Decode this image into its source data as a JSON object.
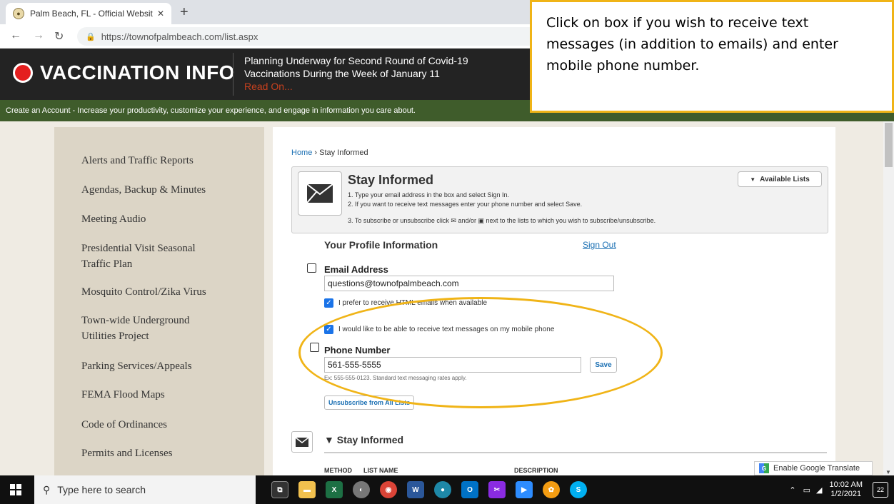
{
  "browser": {
    "tab_title": "Palm Beach, FL - Official Website",
    "tab_close": "✕",
    "new_tab": "+",
    "url": "https://townofpalmbeach.com/list.aspx"
  },
  "header": {
    "vaccination_label": "VACCINATION INFO",
    "news_line1": "Planning Underway for Second Round of Covid-19",
    "news_line2": "Vaccinations During the Week of January 11",
    "read_on": "Read On..."
  },
  "account_bar": "Create an Account - Increase your productivity, customize your experience, and engage in information you care about.",
  "callout_text": "Click on box if you wish to receive text messages (in addition to emails) and enter mobile phone number.",
  "sidebar": {
    "items": [
      "Alerts and Traffic Reports",
      "Agendas, Backup & Minutes",
      "Meeting Audio",
      "Presidential Visit Seasonal Traffic Plan",
      "Mosquito Control/Zika Virus",
      "Town-wide Underground Utilities Project",
      "Parking Services/Appeals",
      "FEMA Flood Maps",
      "Code of Ordinances",
      "Permits and Licenses"
    ]
  },
  "breadcrumb": {
    "home": "Home",
    "sep": " › ",
    "current": "Stay Informed"
  },
  "stay_informed": {
    "title": "Stay Informed",
    "step1": "1. Type your email address in the box and select Sign In.",
    "step2": "2. If you want to receive text messages enter your phone number and select Save.",
    "step3": "3. To subscribe or unsubscribe click ✉ and/or ▣ next to the lists to which you wish to subscribe/unsubscribe.",
    "available_lists": "Available Lists"
  },
  "profile": {
    "heading": "Your Profile Information",
    "sign_out": "Sign Out",
    "email_label": "Email Address",
    "email_value": "questions@townofpalmbeach.com",
    "html_pref": "I prefer to receive HTML emails when available",
    "text_pref": "I would like to be able to receive text messages on my mobile phone",
    "phone_label": "Phone Number",
    "phone_value": "561-555-5555",
    "save": "Save",
    "phone_hint": "Ex: 555-555-0123. Standard text messaging rates apply.",
    "unsubscribe": "Unsubscribe from All Lists"
  },
  "lists": {
    "heading": "▼ Stay Informed",
    "columns": [
      "METHOD",
      "LIST NAME",
      "DESCRIPTION"
    ]
  },
  "translate": "Enable Google Translate",
  "taskbar": {
    "search_placeholder": "Type here to search",
    "time": "10:02 AM",
    "date": "1/2/2021",
    "notifications": "22"
  },
  "colors": {
    "callout_border": "#f0b417",
    "header_bg": "#232323",
    "green_bar": "#3f5c2b",
    "sidebar_bg": "#dcd5c6",
    "link": "#1a6fb3"
  }
}
